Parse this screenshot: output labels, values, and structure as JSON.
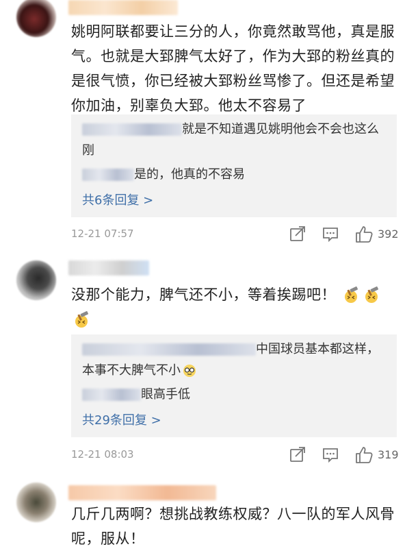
{
  "comments": [
    {
      "text": "姚明阿联都要让三分的人，你竟然敢骂他，真是服气。也就是大郅脾气太好了，作为大郅的粉丝真的是很气愤，你已经被大郅粉丝骂惨了。但还是希望你加油，别辜负大郅。他太不容易了",
      "replies": [
        {
          "text": "就是不知道遇见姚明他会不会也这么刚"
        },
        {
          "text": "是的，他真的不容易"
        }
      ],
      "more_replies": "共6条回复 >",
      "time": "12-21 07:57",
      "likes": "392"
    },
    {
      "text": "没那个能力，脾气还不小，等着挨踢吧！",
      "replies": [
        {
          "text": "中国球员基本都这样，本事不大脾气不小"
        },
        {
          "text": "眼高手低"
        }
      ],
      "more_replies": "共29条回复 >",
      "time": "12-21 08:03",
      "likes": "319"
    },
    {
      "text": "几斤几两啊？想挑战教练权威？八一队的军人风骨呢，服从！"
    }
  ],
  "icons": {
    "share": "share-icon",
    "comment": "comment-icon",
    "like": "thumbs-up-icon",
    "emoji": "hammer-emoji-icon"
  },
  "colors": {
    "link": "#3f6fa8",
    "reply_bg": "#f2f2f2",
    "meta": "#999999"
  }
}
